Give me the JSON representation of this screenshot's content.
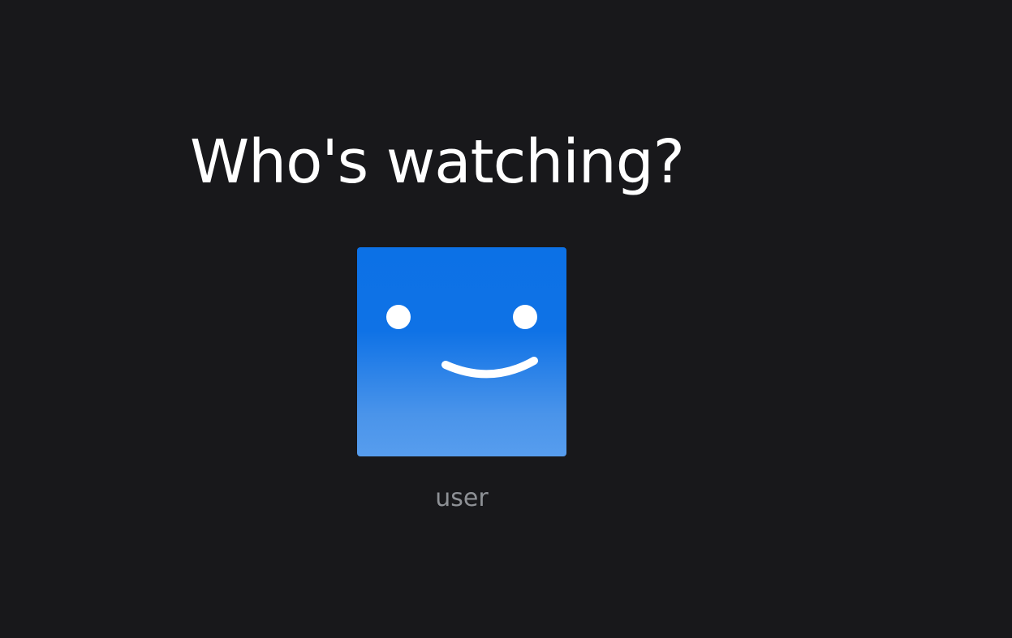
{
  "header": {
    "title": "Who's watching?"
  },
  "profiles": [
    {
      "name": "user",
      "avatar_icon": "smiley-face-icon",
      "avatar_color_top": "#0c71e6",
      "avatar_color_bottom": "#579dee"
    }
  ],
  "colors": {
    "background": "#18181b",
    "title": "#ffffff",
    "profile_name": "#8e9196"
  }
}
